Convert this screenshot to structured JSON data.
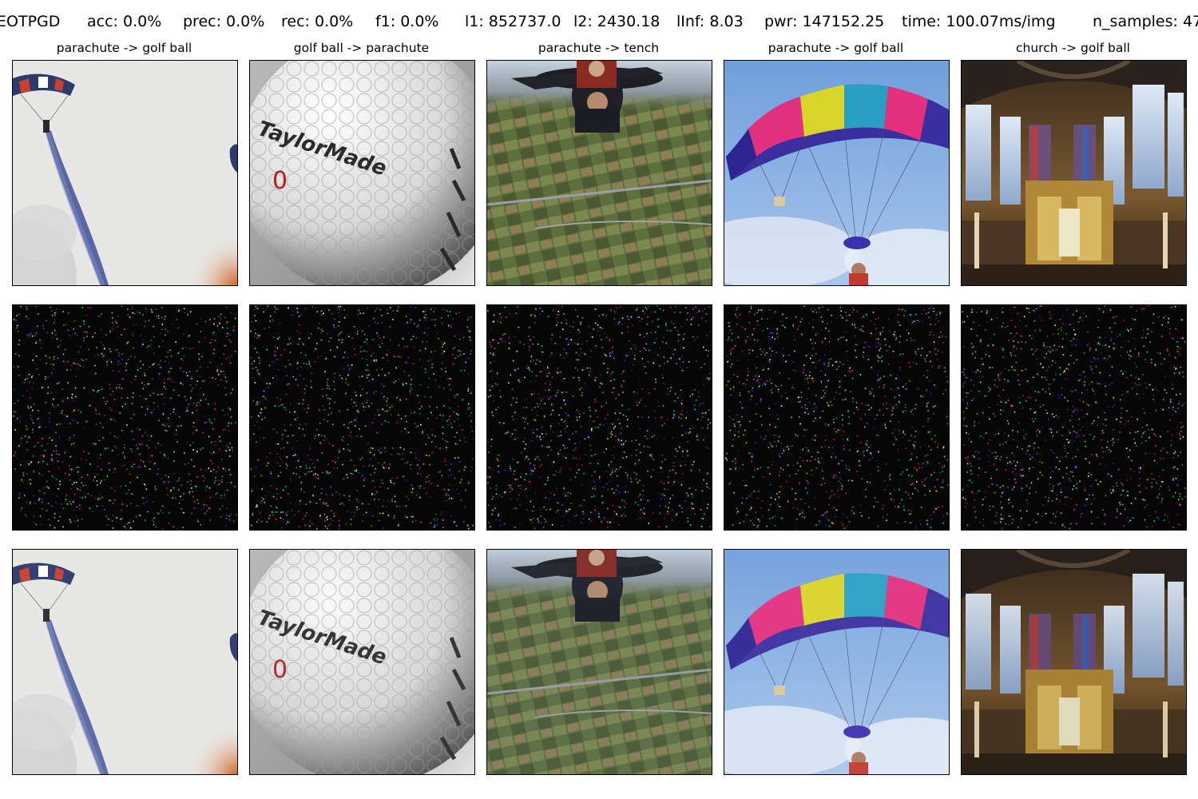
{
  "header": {
    "method": "EOTPGD",
    "acc": "acc: 0.0%",
    "prec": "prec: 0.0%",
    "rec": "rec: 0.0%",
    "f1": "f1: 0.0%",
    "l1": "l1: 852737.0",
    "l2": "l2: 2430.18",
    "linf": "lInf: 8.03",
    "pwr": "pwr: 147152.25",
    "time": "time: 100.07ms/img",
    "n_samples": "n_samples: 47"
  },
  "columns": [
    {
      "title": "parachute -> golf ball",
      "scene": "parachute-smoke"
    },
    {
      "title": "golf ball -> parachute",
      "scene": "golf-ball"
    },
    {
      "title": "parachute -> tench",
      "scene": "skydivers-aerial"
    },
    {
      "title": "parachute -> golf ball",
      "scene": "rainbow-canopy"
    },
    {
      "title": "church -> golf ball",
      "scene": "church-interior"
    }
  ],
  "rows": [
    "original",
    "perturbation",
    "adversarial"
  ],
  "golf_brand": "TaylorMade",
  "golf_number": "0",
  "noise_colors": [
    "#ff2020",
    "#20ff20",
    "#3040ff",
    "#ffffff",
    "#ff40ff",
    "#40ffff",
    "#ffff40"
  ]
}
